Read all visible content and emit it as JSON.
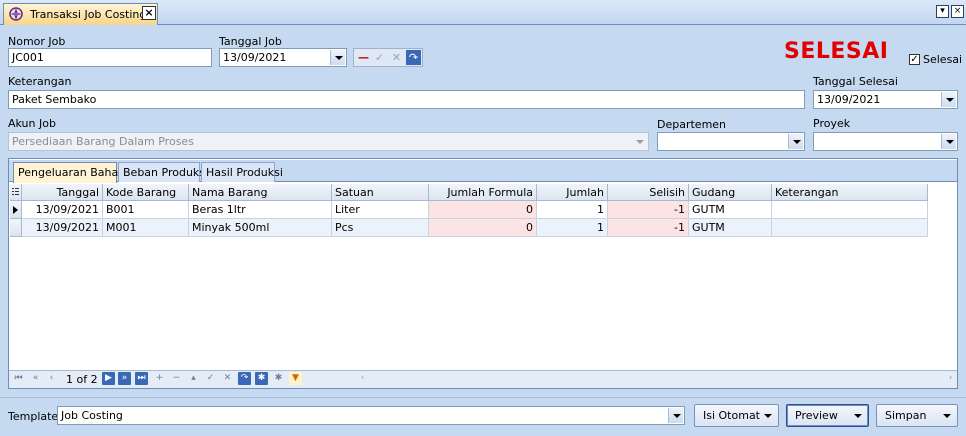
{
  "tab": {
    "title": "Transaksi Job Costing",
    "close": "x"
  },
  "window": {
    "menu_btn": "v",
    "close_btn": "x"
  },
  "header": {
    "nomor_job_label": "Nomor Job",
    "nomor_job_value": "JC001",
    "tanggal_job_label": "Tanggal Job",
    "tanggal_job_value": "13/09/2021",
    "status_text": "SELESAI",
    "selesai_label": "Selesai",
    "selesai_checked": true,
    "keterangan_label": "Keterangan",
    "keterangan_value": "Paket Sembako",
    "tanggal_selesai_label": "Tanggal Selesai",
    "tanggal_selesai_value": "13/09/2021",
    "akun_job_label": "Akun Job",
    "akun_job_value": "Persediaan Barang Dalam Proses",
    "departemen_label": "Departemen",
    "departemen_value": "",
    "proyek_label": "Proyek",
    "proyek_value": ""
  },
  "tabs": [
    {
      "label": "Pengeluaran Bahan",
      "active": true
    },
    {
      "label": "Beban Produksi",
      "active": false
    },
    {
      "label": "Hasil Produksi",
      "active": false
    }
  ],
  "grid": {
    "columns": [
      "Tanggal",
      "Kode Barang",
      "Nama Barang",
      "Satuan",
      "Jumlah Formula",
      "Jumlah",
      "Selisih",
      "Gudang",
      "Keterangan"
    ],
    "rows": [
      {
        "tanggal": "13/09/2021",
        "kode": "B001",
        "nama": "Beras 1ltr",
        "satuan": "Liter",
        "jumlah_formula": "0",
        "jumlah": "1",
        "selisih": "-1",
        "gudang": "GUTM",
        "keterangan": ""
      },
      {
        "tanggal": "13/09/2021",
        "kode": "M001",
        "nama": "Minyak 500ml",
        "satuan": "Pcs",
        "jumlah_formula": "0",
        "jumlah": "1",
        "selisih": "-1",
        "gudang": "GUTM",
        "keterangan": ""
      }
    ]
  },
  "navigator": {
    "page_text": "1 of 2"
  },
  "footer": {
    "template_label": "Template",
    "template_value": "Job Costing",
    "isi_otomat_label": "Isi Otomat",
    "preview_label": "Preview",
    "simpan_label": "Simpan"
  },
  "colors": {
    "status_red": "#e20000",
    "pink_cell": "#fde4e4",
    "background": "#c5d9f1"
  }
}
